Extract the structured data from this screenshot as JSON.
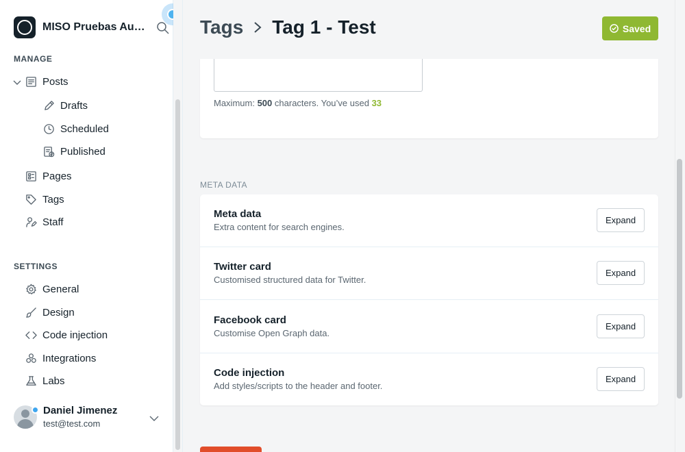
{
  "sidebar": {
    "brand_name": "MISO Pruebas Automatizadas",
    "manage_title": "MANAGE",
    "settings_title": "SETTINGS",
    "manage_items": {
      "posts": "Posts",
      "drafts": "Drafts",
      "scheduled": "Scheduled",
      "published": "Published",
      "pages": "Pages",
      "tags": "Tags",
      "staff": "Staff"
    },
    "settings_items": {
      "general": "General",
      "design": "Design",
      "code_injection": "Code injection",
      "integrations": "Integrations",
      "labs": "Labs"
    },
    "user": {
      "name": "Daniel Jimenez",
      "email": "test@test.com"
    }
  },
  "header": {
    "breadcrumb_parent": "Tags",
    "breadcrumb_current": "Tag 1 - Test",
    "saved_label": "Saved"
  },
  "description": {
    "count_prefix": "Maximum:",
    "max": "500",
    "count_middle": "characters. You’ve used",
    "used": "33"
  },
  "meta_section": {
    "label": "META DATA",
    "rows": [
      {
        "title": "Meta data",
        "desc": "Extra content for search engines.",
        "button": "Expand"
      },
      {
        "title": "Twitter card",
        "desc": "Customised structured data for Twitter.",
        "button": "Expand"
      },
      {
        "title": "Facebook card",
        "desc": "Customise Open Graph data.",
        "button": "Expand"
      },
      {
        "title": "Code injection",
        "desc": "Add styles/scripts to the header and footer.",
        "button": "Expand"
      }
    ]
  },
  "colors": {
    "saved_green": "#8fb832",
    "delete_red": "#e14d2a",
    "notification_blue": "#4fb3ef"
  }
}
